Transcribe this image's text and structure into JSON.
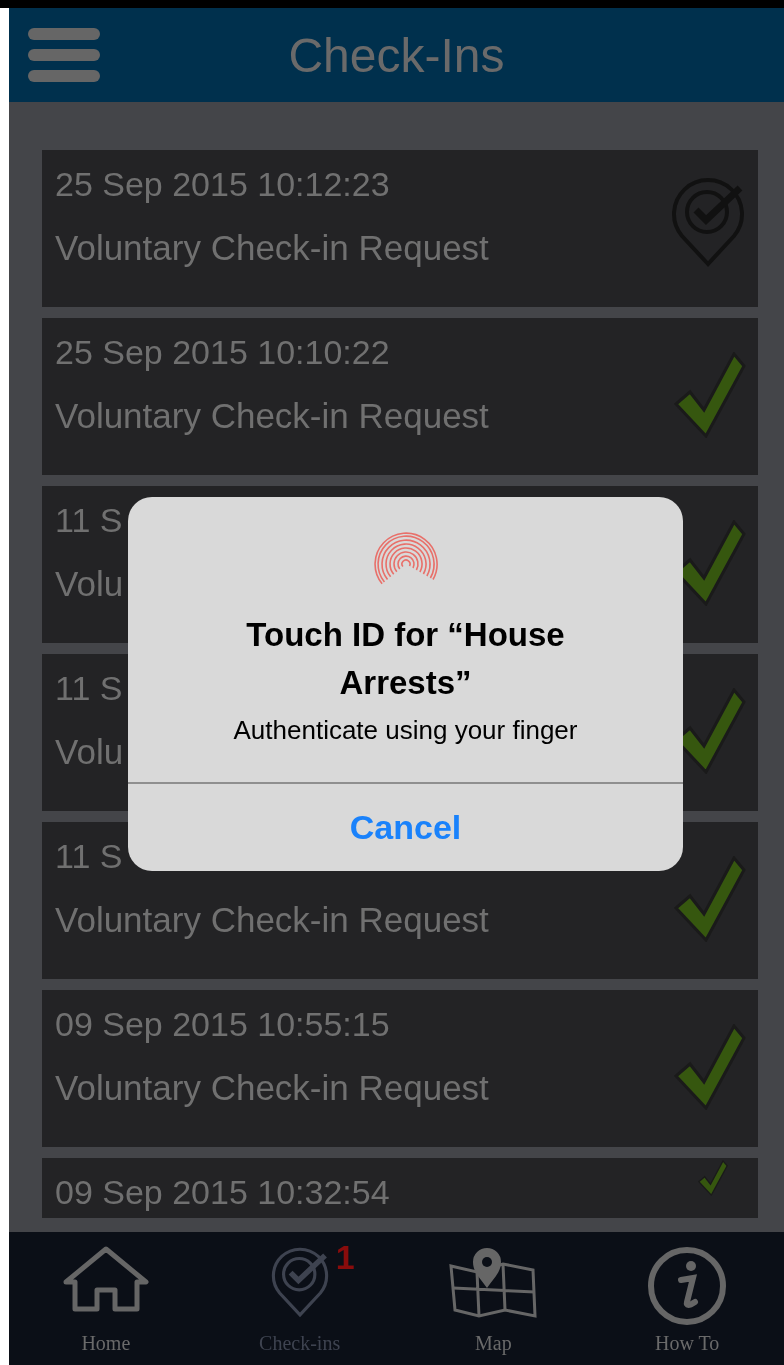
{
  "header": {
    "title": "Check-Ins"
  },
  "checkins": [
    {
      "date": "25 Sep 2015 10:12:23",
      "type": "Voluntary Check-in Request",
      "done": false
    },
    {
      "date": "25 Sep 2015 10:10:22",
      "type": "Voluntary Check-in Request",
      "done": true
    },
    {
      "date": "11 S",
      "type": "Volu",
      "done": true
    },
    {
      "date": "11 S",
      "type": "Volu",
      "done": true
    },
    {
      "date": "11 S",
      "type": "Voluntary Check-in Request",
      "done": true
    },
    {
      "date": "09 Sep 2015 10:55:15",
      "type": "Voluntary Check-in Request",
      "done": true
    },
    {
      "date": "09 Sep 2015 10:32:54",
      "done": true
    }
  ],
  "dialog": {
    "title": "Touch ID for “House Arrests”",
    "message": "Authenticate using your finger",
    "button": "Cancel"
  },
  "nav": [
    {
      "label": "Home",
      "selected": false
    },
    {
      "label": "Check-ins",
      "selected": true,
      "badge": "1"
    },
    {
      "label": "Map",
      "selected": false
    },
    {
      "label": "How To",
      "selected": false
    }
  ]
}
